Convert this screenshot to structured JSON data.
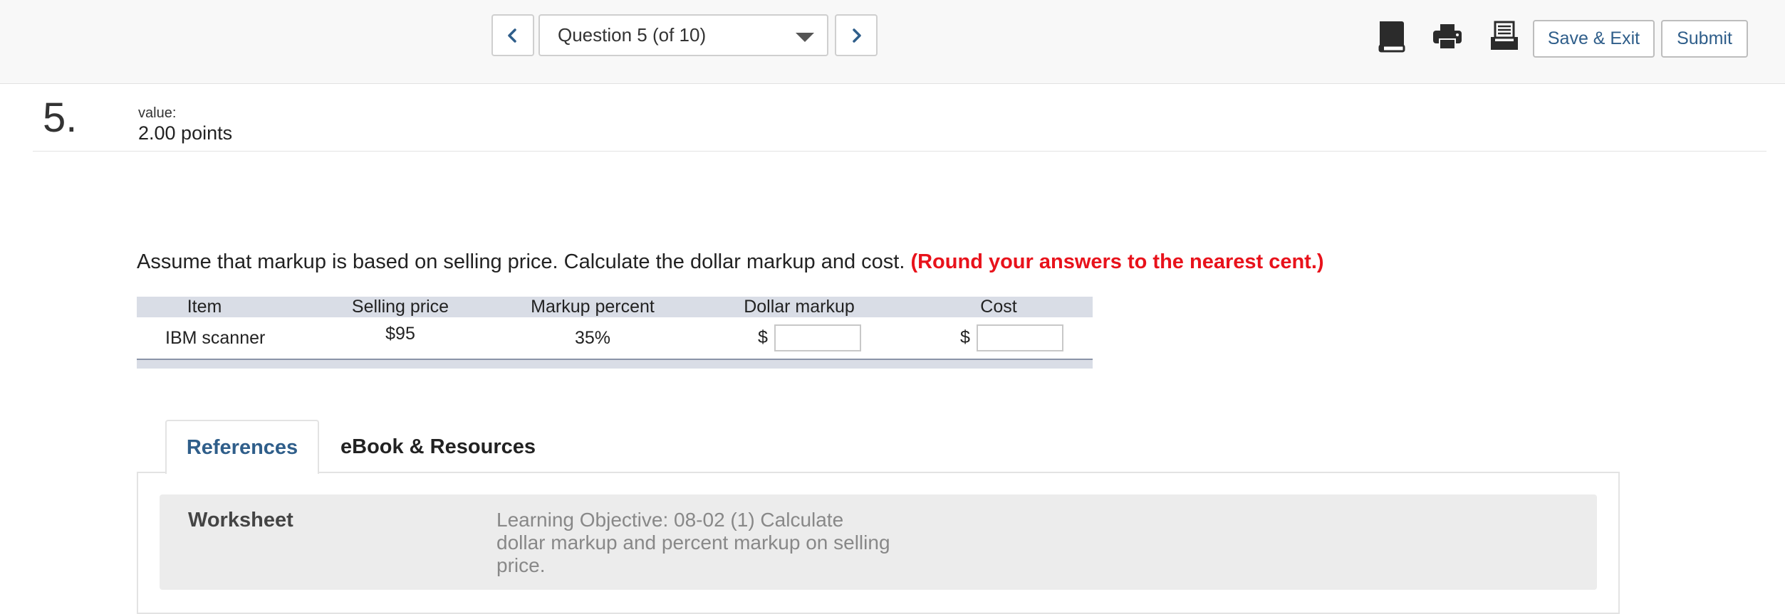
{
  "toolbar": {
    "prev_icon": "chevron-left-icon",
    "next_icon": "chevron-right-icon",
    "question_selector": "Question 5 (of 10)",
    "icons": [
      "ebook-icon",
      "print-icon",
      "worksheet-icon"
    ],
    "save_exit_label": "Save & Exit",
    "submit_label": "Submit",
    "accent_color": "#2f5e8a"
  },
  "question": {
    "number": "5.",
    "value_label": "value:",
    "value_points": "2.00 points",
    "prompt": "Assume that markup is based on selling price. Calculate the dollar markup and cost.",
    "hint": "(Round your answers to the nearest cent.)",
    "hint_color": "#e8121b"
  },
  "table": {
    "headers": [
      "Item",
      "Selling price",
      "Markup percent",
      "Dollar markup",
      "Cost"
    ],
    "row": {
      "item": "IBM scanner",
      "selling_price": "$95",
      "markup_percent": "35%",
      "dollar_markup_prefix": "$",
      "dollar_markup_value": "",
      "cost_prefix": "$",
      "cost_value": ""
    }
  },
  "tabs": [
    {
      "label": "References",
      "active": true
    },
    {
      "label": "eBook & Resources",
      "active": false
    }
  ],
  "reference": {
    "title": "Worksheet",
    "learning_objective": "Learning Objective: 08-02 (1) Calculate dollar markup and percent markup on selling price."
  }
}
